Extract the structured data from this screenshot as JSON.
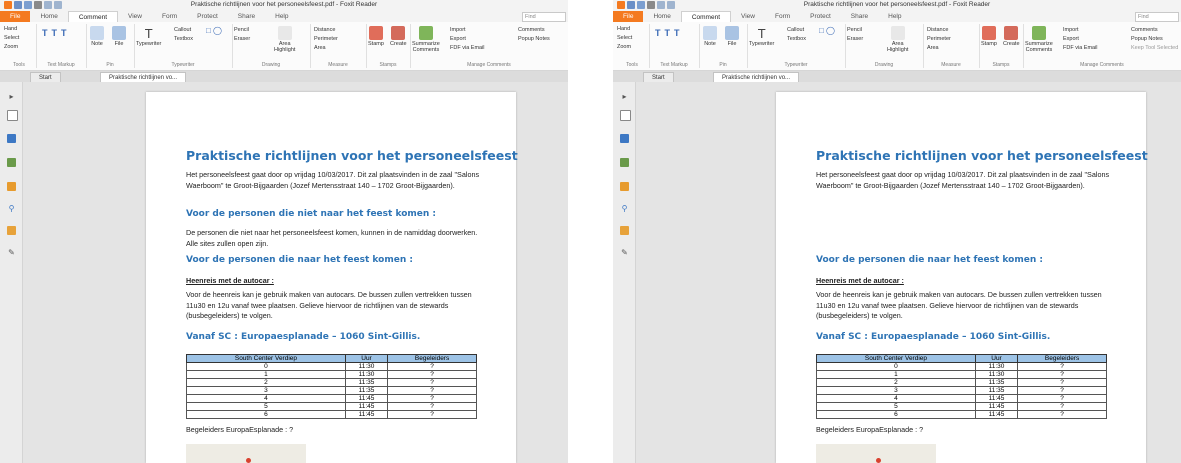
{
  "app": {
    "title": "Praktische richtlijnen voor het personeelsfeest.pdf - Foxit Reader",
    "find_placeholder": "Find"
  },
  "menu_tabs": [
    "File",
    "Home",
    "Comment",
    "View",
    "Form",
    "Protect",
    "Share",
    "Help"
  ],
  "ribbon": {
    "tools": {
      "hand": "Hand",
      "select": "Select",
      "zoom": "Zoom",
      "label": "Tools"
    },
    "text_markup": {
      "label": "Text Markup"
    },
    "pin": {
      "note": "Note",
      "file": "File",
      "label": "Pin"
    },
    "typewriter": {
      "typewriter": "Typewriter",
      "callout": "Callout",
      "textbox": "Textbox",
      "label": "Typewriter"
    },
    "drawing": {
      "pencil": "Pencil",
      "eraser": "Eraser",
      "area_highlight_1": "Area",
      "area_highlight_2": "Highlight",
      "label": "Drawing"
    },
    "measure": {
      "distance": "Distance",
      "perimeter": "Perimeter",
      "area": "Area",
      "label": "Measure"
    },
    "stamps": {
      "stamp": "Stamp",
      "create": "Create",
      "label": "Stamps"
    },
    "manage": {
      "summarize_1": "Summarize",
      "summarize_2": "Comments",
      "import": "Import",
      "export": "Export",
      "pdf_via_email": "FDF via Email",
      "comments": "Comments",
      "popup_notes": "Popup Notes",
      "keep_tool": "Keep Tool Selected",
      "label": "Manage Comments"
    }
  },
  "doc_tabs": {
    "start": "Start",
    "current": "Praktische richtlijnen vo..."
  },
  "document": {
    "title": "Praktische richtlijnen voor het personeelsfeest",
    "intro": "Het personeelsfeest gaat door op vrijdag 10/03/2017. Dit zal plaatsvinden in de zaal \"Salons Waerboom\" te Groot-Bijgaarden (Jozef Mertensstraat 140 – 1702 Groot-Bijgaarden).",
    "section_not_attending": "Voor de personen die niet naar het feest komen :",
    "not_attending_text": "De personen die niet naar het personeelsfeest komen, kunnen in de namiddag doorwerken. Alle sites zullen open zijn.",
    "section_attending": "Voor de personen die naar het feest komen :",
    "heenreis": "Heenreis met de autocar :",
    "heenreis_text": "Voor de heenreis kan je gebruik maken van autocars. De bussen zullen vertrekken tussen 11u30 en 12u vanaf twee plaatsen. Gelieve hiervoor de richtlijnen van de stewards (busbegeleiders) te volgen.",
    "vanaf": "Vanaf SC : Europaesplanade – 1060 Sint-Gillis.",
    "table": {
      "headers": [
        "South Center Verdiep",
        "Uur",
        "Begeleiders"
      ],
      "rows": [
        [
          "0",
          "11:30",
          "?"
        ],
        [
          "1",
          "11:30",
          "?"
        ],
        [
          "2",
          "11:35",
          "?"
        ],
        [
          "3",
          "11:35",
          "?"
        ],
        [
          "4",
          "11:45",
          "?"
        ],
        [
          "5",
          "11:45",
          "?"
        ],
        [
          "6",
          "11:45",
          "?"
        ]
      ]
    },
    "begeleiders": "Begeleiders EuropaEsplanade : ?"
  },
  "colors": {
    "file_tab": "#f47a20",
    "heading": "#2e74b5",
    "table_header": "#9dc3e6"
  }
}
